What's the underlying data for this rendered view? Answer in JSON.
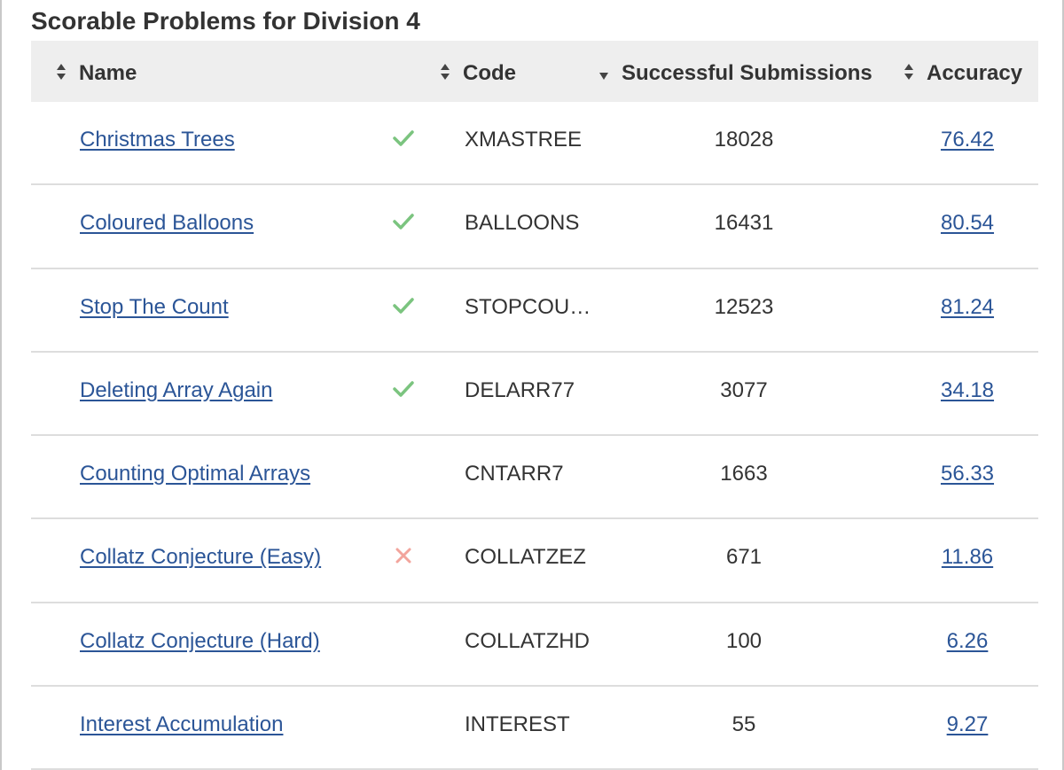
{
  "page": {
    "title": "Scorable Problems for Division 4"
  },
  "columns": {
    "name": "Name",
    "code": "Code",
    "submissions": "Successful Submissions",
    "accuracy": "Accuracy"
  },
  "colors": {
    "link": "#2b5597",
    "solved": "#7bc47f",
    "failed": "#f2a49c"
  },
  "rows": [
    {
      "name": "Christmas Trees",
      "status": "solved",
      "status_icon": "check-icon",
      "code": "XMASTREE",
      "submissions": "18028",
      "accuracy": "76.42"
    },
    {
      "name": "Coloured Balloons",
      "status": "solved",
      "status_icon": "check-icon",
      "code": "BALLOONS",
      "submissions": "16431",
      "accuracy": "80.54"
    },
    {
      "name": "Stop The Count",
      "status": "solved",
      "status_icon": "check-icon",
      "code": "STOPCOU…",
      "submissions": "12523",
      "accuracy": "81.24"
    },
    {
      "name": "Deleting Array Again",
      "status": "solved",
      "status_icon": "check-icon",
      "code": "DELARR77",
      "submissions": "3077",
      "accuracy": "34.18"
    },
    {
      "name": "Counting Optimal Arrays",
      "status": "none",
      "status_icon": "",
      "code": "CNTARR7",
      "submissions": "1663",
      "accuracy": "56.33"
    },
    {
      "name": "Collatz Conjecture (Easy)",
      "status": "failed",
      "status_icon": "cross-icon",
      "code": "COLLATZEZ",
      "submissions": "671",
      "accuracy": "11.86"
    },
    {
      "name": "Collatz Conjecture (Hard)",
      "status": "none",
      "status_icon": "",
      "code": "COLLATZHD",
      "submissions": "100",
      "accuracy": "6.26"
    },
    {
      "name": "Interest Accumulation",
      "status": "none",
      "status_icon": "",
      "code": "INTEREST",
      "submissions": "55",
      "accuracy": "9.27"
    }
  ]
}
